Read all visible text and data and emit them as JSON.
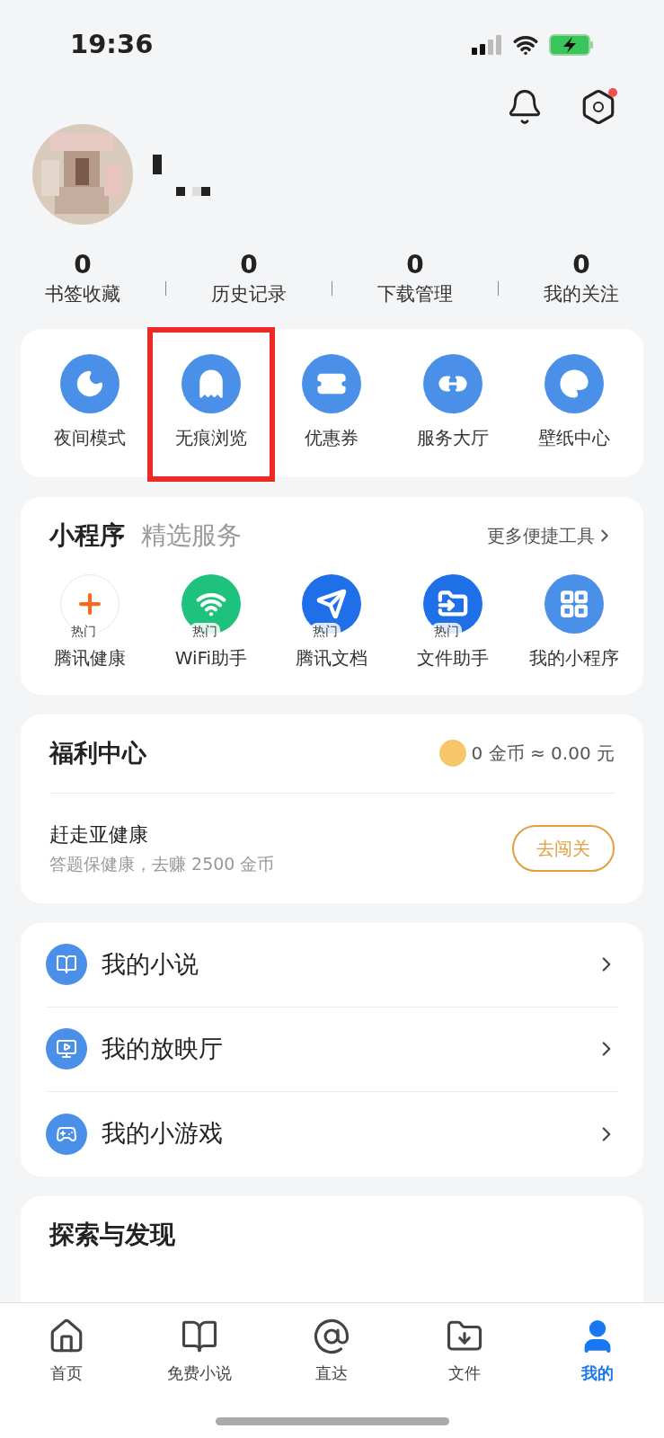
{
  "status_bar": {
    "time": "19:36"
  },
  "header": {
    "settings_badge": true
  },
  "stats": [
    {
      "value": "0",
      "label": "书签收藏"
    },
    {
      "value": "0",
      "label": "历史记录"
    },
    {
      "value": "0",
      "label": "下载管理"
    },
    {
      "value": "0",
      "label": "我的关注"
    }
  ],
  "quick_actions": [
    {
      "label": "夜间模式",
      "highlighted": false
    },
    {
      "label": "无痕浏览",
      "highlighted": true
    },
    {
      "label": "优惠券",
      "highlighted": false
    },
    {
      "label": "服务大厅",
      "highlighted": false
    },
    {
      "label": "壁纸中心",
      "highlighted": false
    }
  ],
  "mini_programs": {
    "title": "小程序",
    "subtitle": "精选服务",
    "more": "更多便捷工具",
    "items": [
      {
        "label": "腾讯健康",
        "badge": "热门"
      },
      {
        "label": "WiFi助手",
        "badge": "热门"
      },
      {
        "label": "腾讯文档",
        "badge": "热门"
      },
      {
        "label": "文件助手",
        "badge": "热门"
      },
      {
        "label": "我的小程序"
      }
    ]
  },
  "welfare": {
    "title": "福利中心",
    "balance": "0 金币 ≈ 0.00 元",
    "task": {
      "title": "赶走亚健康",
      "subtitle": "答题保健康，去赚 2500 金币",
      "button": "去闯关"
    }
  },
  "my_list": [
    {
      "label": "我的小说"
    },
    {
      "label": "我的放映厅"
    },
    {
      "label": "我的小游戏"
    }
  ],
  "explore": {
    "title": "探索与发现"
  },
  "tab_bar": [
    {
      "label": "首页",
      "selected": false
    },
    {
      "label": "免费小说",
      "selected": false
    },
    {
      "label": "直达",
      "selected": false
    },
    {
      "label": "文件",
      "selected": false
    },
    {
      "label": "我的",
      "selected": true
    }
  ]
}
